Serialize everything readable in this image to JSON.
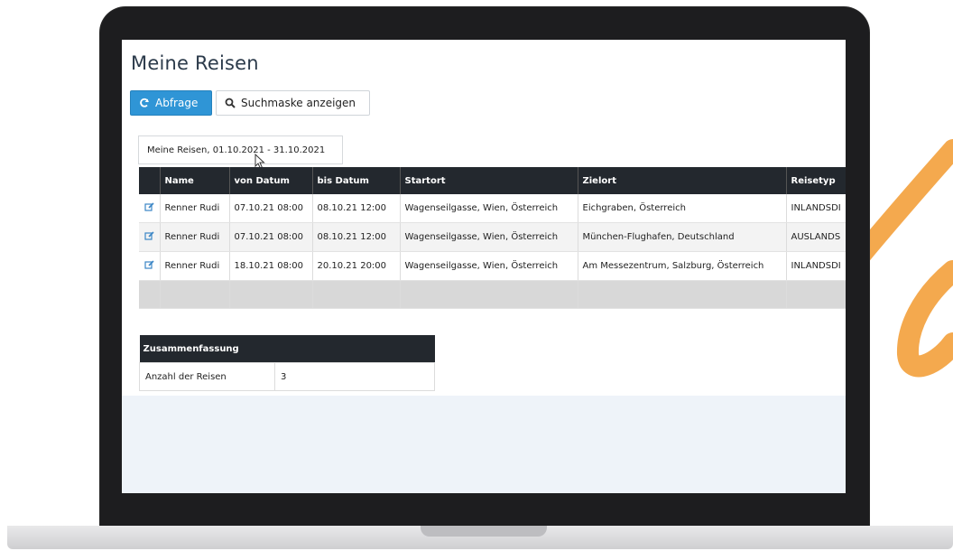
{
  "colors": {
    "accent_swoosh": "#f4a94e",
    "primary_button": "#2f95d6",
    "table_header": "#23282e",
    "edit_icon": "#3b86c6"
  },
  "page": {
    "title": "Meine Reisen"
  },
  "toolbar": {
    "query_icon": "refresh-icon",
    "query_label": "Abfrage",
    "search_icon": "search-icon",
    "search_label": "Suchmaske anzeigen"
  },
  "report": {
    "caption": "Meine Reisen, 01.10.2021 - 31.10.2021",
    "columns": [
      "Name",
      "von Datum",
      "bis Datum",
      "Startort",
      "Zielort",
      "Reisetyp"
    ],
    "rows": [
      {
        "edit_icon": "edit-icon",
        "name": "Renner Rudi",
        "von": "07.10.21 08:00",
        "bis": "08.10.21 12:00",
        "start": "Wagenseilgasse, Wien, Österreich",
        "ziel": "Eichgraben, Österreich",
        "typ": "INLANDSDI"
      },
      {
        "edit_icon": "edit-icon",
        "name": "Renner Rudi",
        "von": "07.10.21 08:00",
        "bis": "08.10.21 12:00",
        "start": "Wagenseilgasse, Wien, Österreich",
        "ziel": "München-Flughafen, Deutschland",
        "typ": "AUSLANDS"
      },
      {
        "edit_icon": "edit-icon",
        "name": "Renner Rudi",
        "von": "18.10.21 08:00",
        "bis": "20.10.21 20:00",
        "start": "Wagenseilgasse, Wien, Österreich",
        "ziel": "Am Messezentrum, Salzburg, Österreich",
        "typ": "INLANDSDI"
      }
    ]
  },
  "summary": {
    "title": "Zusammenfassung",
    "label": "Anzahl der Reisen",
    "value": "3"
  }
}
